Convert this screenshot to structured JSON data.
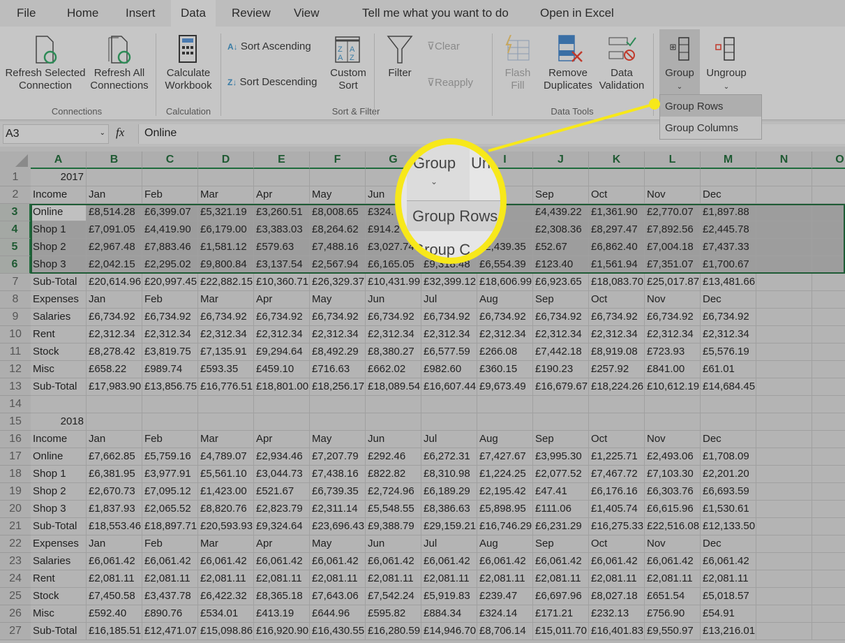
{
  "tabs": [
    {
      "label": "File"
    },
    {
      "label": "Home"
    },
    {
      "label": "Insert"
    },
    {
      "label": "Data",
      "active": true
    },
    {
      "label": "Review"
    },
    {
      "label": "View"
    },
    {
      "label": "Tell me what you want to do"
    },
    {
      "label": "Open in Excel"
    }
  ],
  "ribbon": {
    "refresh_selected": "Refresh Selected",
    "refresh_selected2": "Connection",
    "refresh_all": "Refresh All",
    "refresh_all2": "Connections",
    "calculate": "Calculate",
    "calculate2": "Workbook",
    "sort_asc": "Sort Ascending",
    "sort_desc": "Sort Descending",
    "custom_sort": "Custom",
    "custom_sort2": "Sort",
    "filter": "Filter",
    "clear": "Clear",
    "reapply": "Reapply",
    "flash_fill": "Flash",
    "flash_fill2": "Fill",
    "remove_dup": "Remove",
    "remove_dup2": "Duplicates",
    "validation": "Data",
    "validation2": "Validation",
    "group": "Group",
    "ungroup": "Ungroup",
    "groups": {
      "connections": "Connections",
      "calculation": "Calculation",
      "sort_filter": "Sort & Filter",
      "data_tools": "Data Tools"
    }
  },
  "group_menu": {
    "items": [
      "Group Rows",
      "Group Columns"
    ]
  },
  "formula_bar": {
    "name_box": "A3",
    "fx": "fx",
    "value": "Online"
  },
  "magnifier": {
    "button": "Group",
    "next": "Un",
    "menu_item": "Group Rows",
    "menu_item2": "Group C"
  },
  "accent_color": "#f7e81a",
  "columns": [
    "A",
    "B",
    "C",
    "D",
    "E",
    "F",
    "G",
    "H",
    "I",
    "J",
    "K",
    "L",
    "M",
    "N",
    "O"
  ],
  "selected_rows": [
    3,
    4,
    5,
    6
  ],
  "rows": [
    [
      "2017"
    ],
    [
      "Income",
      "Jan",
      "Feb",
      "Mar",
      "Apr",
      "May",
      "Jun",
      "Jul",
      "Aug",
      "Sep",
      "Oct",
      "Nov",
      "Dec"
    ],
    [
      "Online",
      "£8,514.28",
      "£6,399.07",
      "£5,321.19",
      "£3,260.51",
      "£8,008.65",
      "£324.",
      "",
      "",
      "£4,439.22",
      "£1,361.90",
      "£2,770.07",
      "£1,897.88"
    ],
    [
      "Shop 1",
      "£7,091.05",
      "£4,419.90",
      "£6,179.00",
      "£3,383.03",
      "£8,264.62",
      "£914.2",
      "",
      "£",
      "£2,308.36",
      "£8,297.47",
      "£7,892.56",
      "£2,445.78"
    ],
    [
      "Shop 2",
      "£2,967.48",
      "£7,883.46",
      "£1,581.12",
      "£579.63",
      "£7,488.16",
      "£3,027.74",
      "",
      "£2,439.35",
      "£52.67",
      "£6,862.40",
      "£7,004.18",
      "£7,437.33"
    ],
    [
      "Shop 3",
      "£2,042.15",
      "£2,295.02",
      "£9,800.84",
      "£3,137.54",
      "£2,567.94",
      "£6,165.05",
      "£9,318.48",
      "£6,554.39",
      "£123.40",
      "£1,561.94",
      "£7,351.07",
      "£1,700.67"
    ],
    [
      "Sub-Total",
      "£20,614.96",
      "£20,997.45",
      "£22,882.15",
      "£10,360.71",
      "£26,329.37",
      "£10,431.99",
      "£32,399.12",
      "£18,606.99",
      "£6,923.65",
      "£18,083.70",
      "£25,017.87",
      "£13,481.66"
    ],
    [
      "Expenses",
      "Jan",
      "Feb",
      "Mar",
      "Apr",
      "May",
      "Jun",
      "Jul",
      "Aug",
      "Sep",
      "Oct",
      "Nov",
      "Dec"
    ],
    [
      "Salaries",
      "£6,734.92",
      "£6,734.92",
      "£6,734.92",
      "£6,734.92",
      "£6,734.92",
      "£6,734.92",
      "£6,734.92",
      "£6,734.92",
      "£6,734.92",
      "£6,734.92",
      "£6,734.92",
      "£6,734.92"
    ],
    [
      "Rent",
      "£2,312.34",
      "£2,312.34",
      "£2,312.34",
      "£2,312.34",
      "£2,312.34",
      "£2,312.34",
      "£2,312.34",
      "£2,312.34",
      "£2,312.34",
      "£2,312.34",
      "£2,312.34",
      "£2,312.34"
    ],
    [
      "Stock",
      "£8,278.42",
      "£3,819.75",
      "£7,135.91",
      "£9,294.64",
      "£8,492.29",
      "£8,380.27",
      "£6,577.59",
      "£266.08",
      "£7,442.18",
      "£8,919.08",
      "£723.93",
      "£5,576.19"
    ],
    [
      "Misc",
      "£658.22",
      "£989.74",
      "£593.35",
      "£459.10",
      "£716.63",
      "£662.02",
      "£982.60",
      "£360.15",
      "£190.23",
      "£257.92",
      "£841.00",
      "£61.01"
    ],
    [
      "Sub-Total",
      "£17,983.90",
      "£13,856.75",
      "£16,776.51",
      "£18,801.00",
      "£18,256.17",
      "£18,089.54",
      "£16,607.44",
      "£9,673.49",
      "£16,679.67",
      "£18,224.26",
      "£10,612.19",
      "£14,684.45"
    ],
    [],
    [
      "2018"
    ],
    [
      "Income",
      "Jan",
      "Feb",
      "Mar",
      "Apr",
      "May",
      "Jun",
      "Jul",
      "Aug",
      "Sep",
      "Oct",
      "Nov",
      "Dec"
    ],
    [
      "Online",
      "£7,662.85",
      "£5,759.16",
      "£4,789.07",
      "£2,934.46",
      "£7,207.79",
      "£292.46",
      "£6,272.31",
      "£7,427.67",
      "£3,995.30",
      "£1,225.71",
      "£2,493.06",
      "£1,708.09"
    ],
    [
      "Shop 1",
      "£6,381.95",
      "£3,977.91",
      "£5,561.10",
      "£3,044.73",
      "£7,438.16",
      "£822.82",
      "£8,310.98",
      "£1,224.25",
      "£2,077.52",
      "£7,467.72",
      "£7,103.30",
      "£2,201.20"
    ],
    [
      "Shop 2",
      "£2,670.73",
      "£7,095.12",
      "£1,423.00",
      "£521.67",
      "£6,739.35",
      "£2,724.96",
      "£6,189.29",
      "£2,195.42",
      "£47.41",
      "£6,176.16",
      "£6,303.76",
      "£6,693.59"
    ],
    [
      "Shop 3",
      "£1,837.93",
      "£2,065.52",
      "£8,820.76",
      "£2,823.79",
      "£2,311.14",
      "£5,548.55",
      "£8,386.63",
      "£5,898.95",
      "£111.06",
      "£1,405.74",
      "£6,615.96",
      "£1,530.61"
    ],
    [
      "Sub-Total",
      "£18,553.46",
      "£18,897.71",
      "£20,593.93",
      "£9,324.64",
      "£23,696.43",
      "£9,388.79",
      "£29,159.21",
      "£16,746.29",
      "£6,231.29",
      "£16,275.33",
      "£22,516.08",
      "£12,133.50"
    ],
    [
      "Expenses",
      "Jan",
      "Feb",
      "Mar",
      "Apr",
      "May",
      "Jun",
      "Jul",
      "Aug",
      "Sep",
      "Oct",
      "Nov",
      "Dec"
    ],
    [
      "Salaries",
      "£6,061.42",
      "£6,061.42",
      "£6,061.42",
      "£6,061.42",
      "£6,061.42",
      "£6,061.42",
      "£6,061.42",
      "£6,061.42",
      "£6,061.42",
      "£6,061.42",
      "£6,061.42",
      "£6,061.42"
    ],
    [
      "Rent",
      "£2,081.11",
      "£2,081.11",
      "£2,081.11",
      "£2,081.11",
      "£2,081.11",
      "£2,081.11",
      "£2,081.11",
      "£2,081.11",
      "£2,081.11",
      "£2,081.11",
      "£2,081.11",
      "£2,081.11"
    ],
    [
      "Stock",
      "£7,450.58",
      "£3,437.78",
      "£6,422.32",
      "£8,365.18",
      "£7,643.06",
      "£7,542.24",
      "£5,919.83",
      "£239.47",
      "£6,697.96",
      "£8,027.18",
      "£651.54",
      "£5,018.57"
    ],
    [
      "Misc",
      "£592.40",
      "£890.76",
      "£534.01",
      "£413.19",
      "£644.96",
      "£595.82",
      "£884.34",
      "£324.14",
      "£171.21",
      "£232.13",
      "£756.90",
      "£54.91"
    ],
    [
      "Sub-Total",
      "£16,185.51",
      "£12,471.07",
      "£15,098.86",
      "£16,920.90",
      "£16,430.55",
      "£16,280.59",
      "£14,946.70",
      "£8,706.14",
      "£15,011.70",
      "£16,401.83",
      "£9,550.97",
      "£13,216.01"
    ]
  ]
}
